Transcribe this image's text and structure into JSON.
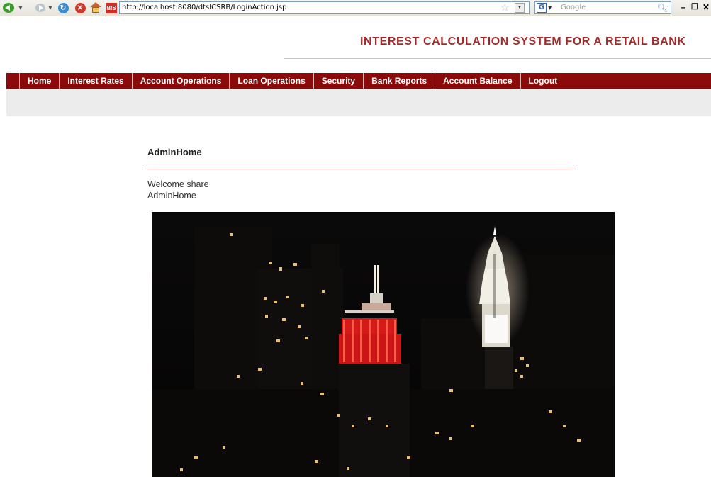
{
  "browser": {
    "url": "http://localhost:8080/dtsICSRB/LoginAction.jsp",
    "search_placeholder": "Google",
    "google_badge": "G",
    "favicon_text": "BIS"
  },
  "header": {
    "title": "INTEREST CALCULATION SYSTEM FOR A RETAIL BANK"
  },
  "nav": {
    "items": [
      {
        "label": "Home"
      },
      {
        "label": "Interest Rates"
      },
      {
        "label": "Account Operations"
      },
      {
        "label": "Loan Operations"
      },
      {
        "label": "Security"
      },
      {
        "label": "Bank Reports"
      },
      {
        "label": "Account Balance"
      },
      {
        "label": "Logout"
      }
    ],
    "bar_color": "#8b0a0a"
  },
  "main": {
    "heading": "AdminHome",
    "welcome": "Welcome share",
    "subtitle": "AdminHome"
  },
  "icons": {
    "back": "back-arrow-icon",
    "forward": "forward-arrow-icon",
    "reload": "reload-icon",
    "stop": "stop-icon",
    "home": "home-icon",
    "bookmark": "star-icon",
    "search": "search-icon"
  },
  "colors": {
    "title": "#a52a2a",
    "accent_red": "#d51a1a"
  }
}
